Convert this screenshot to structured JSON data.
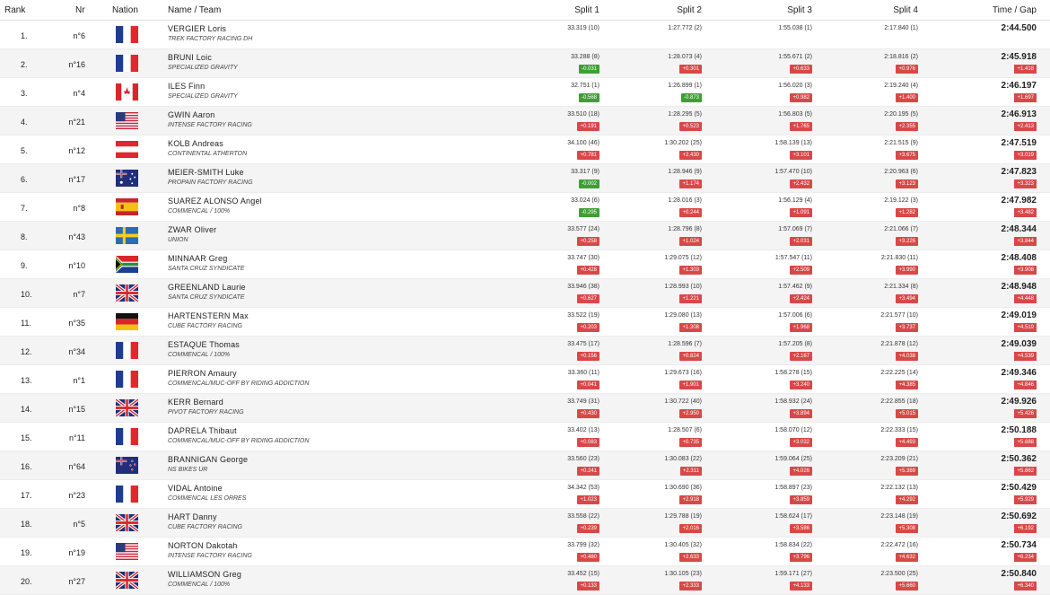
{
  "header": {
    "rank": "Rank",
    "nr": "Nr",
    "nation": "Nation",
    "name_team": "Name / Team",
    "split1": "Split 1",
    "split2": "Split 2",
    "split3": "Split 3",
    "split4": "Split 4",
    "time_gap": "Time / Gap"
  },
  "colors": {
    "gap_positive": "#d84848",
    "gap_negative": "#3f9f35",
    "row_alt": "#f4f4f4"
  },
  "rows": [
    {
      "rank": "1.",
      "nr": "n°6",
      "flag": "fr",
      "name": "VERGIER Loris",
      "team": "TREK FACTORY RACING DH",
      "s1": "33.319 (10)",
      "g1": "",
      "s2": "1:27.772 (2)",
      "g2": "",
      "s3": "1:55.038 (1)",
      "g3": "",
      "s4": "2:17.840 (1)",
      "g4": "",
      "time": "2:44.500",
      "gap": ""
    },
    {
      "rank": "2.",
      "nr": "n°16",
      "flag": "fr",
      "name": "BRUNI Loic",
      "team": "SPECIALIZED GRAVITY",
      "s1": "33.288 (8)",
      "g1": "-0.031",
      "s2": "1:28.073 (4)",
      "g2": "+0.301",
      "s3": "1:55.671 (2)",
      "g3": "+0.633",
      "s4": "2:18.816 (2)",
      "g4": "+0.976",
      "time": "2:45.918",
      "gap": "+1.418"
    },
    {
      "rank": "3.",
      "nr": "n°4",
      "flag": "ca",
      "name": "ILES Finn",
      "team": "SPECIALIZED GRAVITY",
      "s1": "32.751 (1)",
      "g1": "-0.568",
      "s2": "1:26.899 (1)",
      "g2": "-0.873",
      "s3": "1:56.020 (3)",
      "g3": "+0.982",
      "s4": "2:19.240 (4)",
      "g4": "+1.400",
      "time": "2:46.197",
      "gap": "+1.697"
    },
    {
      "rank": "4.",
      "nr": "n°21",
      "flag": "us",
      "name": "GWIN Aaron",
      "team": "INTENSE FACTORY RACING",
      "s1": "33.510 (18)",
      "g1": "+0.191",
      "s2": "1:28.295 (5)",
      "g2": "+0.523",
      "s3": "1:56.803 (5)",
      "g3": "+1.765",
      "s4": "2:20.195 (5)",
      "g4": "+2.355",
      "time": "2:46.913",
      "gap": "+2.413"
    },
    {
      "rank": "5.",
      "nr": "n°12",
      "flag": "at",
      "name": "KOLB Andreas",
      "team": "CONTINENTAL ATHERTON",
      "s1": "34.100 (46)",
      "g1": "+0.781",
      "s2": "1:30.202 (25)",
      "g2": "+2.430",
      "s3": "1:58.139 (13)",
      "g3": "+3.101",
      "s4": "2:21.515 (9)",
      "g4": "+3.675",
      "time": "2:47.519",
      "gap": "+3.019"
    },
    {
      "rank": "6.",
      "nr": "n°17",
      "flag": "au",
      "name": "MEIER-SMITH Luke",
      "team": "PROPAIN FACTORY RACING",
      "s1": "33.317 (9)",
      "g1": "-0.002",
      "s2": "1:28.946 (9)",
      "g2": "+1.174",
      "s3": "1:57.470 (10)",
      "g3": "+2.432",
      "s4": "2:20.963 (6)",
      "g4": "+3.123",
      "time": "2:47.823",
      "gap": "+3.323"
    },
    {
      "rank": "7.",
      "nr": "n°8",
      "flag": "es",
      "name": "SUAREZ ALONSO Angel",
      "team": "COMMENCAL / 100%",
      "s1": "33.024 (6)",
      "g1": "-0.295",
      "s2": "1:28.016 (3)",
      "g2": "+0.244",
      "s3": "1:56.129 (4)",
      "g3": "+1.091",
      "s4": "2:19.122 (3)",
      "g4": "+1.282",
      "time": "2:47.982",
      "gap": "+3.482"
    },
    {
      "rank": "8.",
      "nr": "n°43",
      "flag": "se",
      "name": "ZWAR Oliver",
      "team": "UNION",
      "s1": "33.577 (24)",
      "g1": "+0.258",
      "s2": "1:28.796 (8)",
      "g2": "+1.024",
      "s3": "1:57.069 (7)",
      "g3": "+2.031",
      "s4": "2:21.066 (7)",
      "g4": "+3.226",
      "time": "2:48.344",
      "gap": "+3.844"
    },
    {
      "rank": "9.",
      "nr": "n°10",
      "flag": "za",
      "name": "MINNAAR Greg",
      "team": "SANTA CRUZ SYNDICATE",
      "s1": "33.747 (30)",
      "g1": "+0.428",
      "s2": "1:29.075 (12)",
      "g2": "+1.303",
      "s3": "1:57.547 (11)",
      "g3": "+2.509",
      "s4": "2:21.830 (11)",
      "g4": "+3.990",
      "time": "2:48.408",
      "gap": "+3.908"
    },
    {
      "rank": "10.",
      "nr": "n°7",
      "flag": "gb",
      "name": "GREENLAND Laurie",
      "team": "SANTA CRUZ SYNDICATE",
      "s1": "33.946 (38)",
      "g1": "+0.627",
      "s2": "1:28.993 (10)",
      "g2": "+1.221",
      "s3": "1:57.462 (9)",
      "g3": "+2.424",
      "s4": "2:21.334 (8)",
      "g4": "+3.494",
      "time": "2:48.948",
      "gap": "+4.448"
    },
    {
      "rank": "11.",
      "nr": "n°35",
      "flag": "de",
      "name": "HARTENSTERN Max",
      "team": "CUBE FACTORY RACING",
      "s1": "33.522 (19)",
      "g1": "+0.203",
      "s2": "1:29.080 (13)",
      "g2": "+1.308",
      "s3": "1:57.006 (6)",
      "g3": "+1.968",
      "s4": "2:21.577 (10)",
      "g4": "+3.737",
      "time": "2:49.019",
      "gap": "+4.519"
    },
    {
      "rank": "12.",
      "nr": "n°34",
      "flag": "fr",
      "name": "ESTAQUE Thomas",
      "team": "COMMENCAL / 100%",
      "s1": "33.475 (17)",
      "g1": "+0.156",
      "s2": "1:28.596 (7)",
      "g2": "+0.824",
      "s3": "1:57.205 (8)",
      "g3": "+2.167",
      "s4": "2:21.878 (12)",
      "g4": "+4.038",
      "time": "2:49.039",
      "gap": "+4.539"
    },
    {
      "rank": "13.",
      "nr": "n°1",
      "flag": "fr",
      "name": "PIERRON Amaury",
      "team": "COMMENCAL/MUC-OFF BY RIDING ADDICTION",
      "s1": "33.360 (11)",
      "g1": "+0.041",
      "s2": "1:29.673 (16)",
      "g2": "+1.901",
      "s3": "1:58.278 (15)",
      "g3": "+3.240",
      "s4": "2:22.225 (14)",
      "g4": "+4.385",
      "time": "2:49.346",
      "gap": "+4.846"
    },
    {
      "rank": "14.",
      "nr": "n°15",
      "flag": "gb",
      "name": "KERR Bernard",
      "team": "PIVOT FACTORY RACING",
      "s1": "33.749 (31)",
      "g1": "+0.430",
      "s2": "1:30.722 (40)",
      "g2": "+2.950",
      "s3": "1:58.932 (24)",
      "g3": "+3.894",
      "s4": "2:22.855 (18)",
      "g4": "+5.015",
      "time": "2:49.926",
      "gap": "+5.426"
    },
    {
      "rank": "15.",
      "nr": "n°11",
      "flag": "fr",
      "name": "DAPRELA Thibaut",
      "team": "COMMENCAL/MUC-OFF BY RIDING ADDICTION",
      "s1": "33.402 (13)",
      "g1": "+0.083",
      "s2": "1:28.507 (6)",
      "g2": "+0.735",
      "s3": "1:58.070 (12)",
      "g3": "+3.032",
      "s4": "2:22.333 (15)",
      "g4": "+4.493",
      "time": "2:50.188",
      "gap": "+5.688"
    },
    {
      "rank": "16.",
      "nr": "n°64",
      "flag": "nz",
      "name": "BRANNIGAN George",
      "team": "NS BIKES UR",
      "s1": "33.560 (23)",
      "g1": "+0.241",
      "s2": "1:30.083 (22)",
      "g2": "+2.311",
      "s3": "1:59.064 (25)",
      "g3": "+4.026",
      "s4": "2:23.209 (21)",
      "g4": "+5.369",
      "time": "2:50.362",
      "gap": "+5.862"
    },
    {
      "rank": "17.",
      "nr": "n°23",
      "flag": "fr",
      "name": "VIDAL Antoine",
      "team": "COMMENCAL LES ORRES",
      "s1": "34.342 (53)",
      "g1": "+1.023",
      "s2": "1:30.690 (36)",
      "g2": "+2.918",
      "s3": "1:58.897 (23)",
      "g3": "+3.859",
      "s4": "2:22.132 (13)",
      "g4": "+4.292",
      "time": "2:50.429",
      "gap": "+5.929"
    },
    {
      "rank": "18.",
      "nr": "n°5",
      "flag": "gb",
      "name": "HART Danny",
      "team": "CUBE FACTORY RACING",
      "s1": "33.558 (22)",
      "g1": "+0.239",
      "s2": "1:29.788 (19)",
      "g2": "+2.016",
      "s3": "1:58.624 (17)",
      "g3": "+3.586",
      "s4": "2:23.148 (19)",
      "g4": "+5.308",
      "time": "2:50.692",
      "gap": "+6.192"
    },
    {
      "rank": "19.",
      "nr": "n°19",
      "flag": "us",
      "name": "NORTON Dakotah",
      "team": "INTENSE FACTORY RACING",
      "s1": "33.799 (32)",
      "g1": "+0.480",
      "s2": "1:30.405 (32)",
      "g2": "+2.633",
      "s3": "1:58.834 (22)",
      "g3": "+3.796",
      "s4": "2:22.472 (16)",
      "g4": "+4.632",
      "time": "2:50.734",
      "gap": "+6.234"
    },
    {
      "rank": "20.",
      "nr": "n°27",
      "flag": "gb",
      "name": "WILLIAMSON Greg",
      "team": "COMMENCAL / 100%",
      "s1": "33.452 (15)",
      "g1": "+0.133",
      "s2": "1:30.105 (23)",
      "g2": "+2.333",
      "s3": "1:59.171 (27)",
      "g3": "+4.133",
      "s4": "2:23.500 (25)",
      "g4": "+5.660",
      "time": "2:50.840",
      "gap": "+6.340"
    }
  ]
}
